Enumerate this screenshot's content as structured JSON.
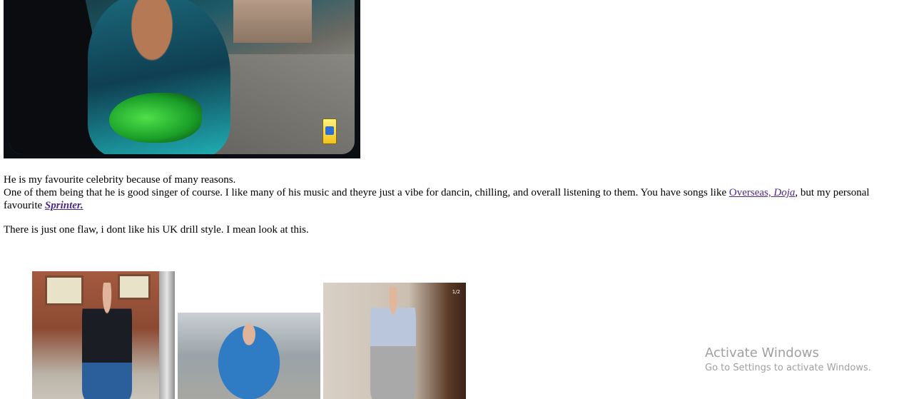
{
  "page": {
    "paragraph1": "He is my favourite celebrity because of many reasons.",
    "paragraph2_start": "One of them being that he is good singer of course. I like many of his music and theyre just a vibe for dancin, chilling, and overall listening to them. You have songs like ",
    "link_overseas": "Overseas, ",
    "link_doja": "Doja",
    "paragraph2_mid": ", but my personal favourite ",
    "link_sprinter": "Sprinter.",
    "paragraph3": "There is just one flaw, i dont like his UK drill style. I mean look at this."
  },
  "images": {
    "photo3_counter": "1/2"
  },
  "watermark": {
    "title": "Activate Windows",
    "subtitle": "Go to Settings to activate Windows."
  },
  "colors": {
    "link": "#4b2a87",
    "watermark": "#a0a0a0"
  }
}
